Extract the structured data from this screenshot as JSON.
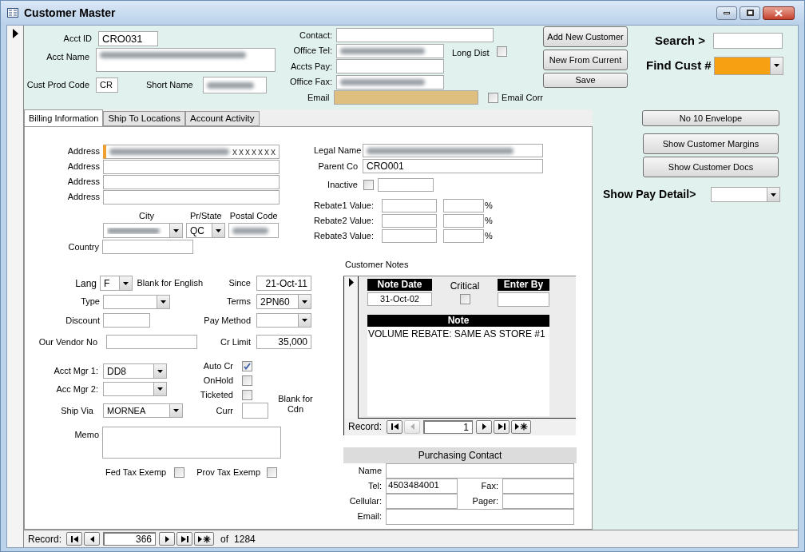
{
  "window": {
    "title": "Customer Master"
  },
  "header": {
    "acct_id": {
      "label": "Acct ID",
      "value": "CRO031"
    },
    "acct_name": {
      "label": "Acct Name",
      "redacted": true
    },
    "cust_prod_code": {
      "label": "Cust Prod Code",
      "value": "CR"
    },
    "short_name": {
      "label": "Short Name",
      "redacted": true
    },
    "contact_fields": [
      {
        "label": "Contact:",
        "redacted": false,
        "highlighted": false
      },
      {
        "label": "Office Tel:",
        "redacted": true,
        "highlighted": false
      },
      {
        "label": "Accts Pay:",
        "redacted": false,
        "highlighted": false
      },
      {
        "label": "Office Fax:",
        "redacted": true,
        "highlighted": false
      },
      {
        "label": "Email",
        "redacted": false,
        "highlighted": true
      }
    ],
    "long_dist": {
      "label": "Long Dist",
      "checked": false
    },
    "email_corr": {
      "label": "Email Corr",
      "checked": false
    },
    "buttons": [
      "Add New Customer",
      "New From Current",
      "Save"
    ],
    "search": {
      "label": "Search >"
    },
    "find_cust": {
      "label": "Find Cust #",
      "highlighted": true
    }
  },
  "tabs": [
    {
      "label": "Billing Information",
      "selected": true
    },
    {
      "label": "Ship To Locations",
      "selected": false
    },
    {
      "label": "Account Activity",
      "selected": false
    }
  ],
  "side_buttons": [
    "No 10 Envelope",
    "Show Customer Margins",
    "Show Customer Docs"
  ],
  "pay_detail": {
    "label": "Show Pay Detail>"
  },
  "billing": {
    "addresses": [
      {
        "label": "Address",
        "value": "xxxxxxx",
        "redacted": true,
        "focused": true
      },
      {
        "label": "Address",
        "redacted": false,
        "focused": false
      },
      {
        "label": "Address",
        "redacted": false,
        "focused": false
      },
      {
        "label": "Address",
        "redacted": false,
        "focused": false
      }
    ],
    "city": {
      "label": "City",
      "redacted": true
    },
    "state": {
      "label": "Pr/State",
      "value": "QC"
    },
    "postal": {
      "label": "Postal Code",
      "redacted": true
    },
    "country": {
      "label": "Country"
    },
    "lang": {
      "label": "Lang",
      "value": "F",
      "hint": "Blank for English"
    },
    "type": {
      "label": "Type"
    },
    "discount": {
      "label": "Discount"
    },
    "vendor_no": {
      "label": "Our Vendor No"
    },
    "since": {
      "label": "Since",
      "value": "21-Oct-11"
    },
    "terms": {
      "label": "Terms",
      "value": "2PN60"
    },
    "pay_method": {
      "label": "Pay Method"
    },
    "cr_limit": {
      "label": "Cr Limit",
      "value": "35,000"
    },
    "acct_mgr_1": {
      "label": "Acct Mgr 1:",
      "value": "DD8"
    },
    "acct_mgr_2": {
      "label": "Acc Mgr 2:"
    },
    "ship_via": {
      "label": "Ship Via",
      "value": "MORNEA"
    },
    "flags": [
      {
        "label": "Auto Cr",
        "checked": true
      },
      {
        "label": "OnHold",
        "checked": false
      },
      {
        "label": "Ticketed",
        "checked": false
      }
    ],
    "curr": {
      "label": "Curr",
      "hint": "Blank for Cdn"
    },
    "memo": {
      "label": "Memo"
    },
    "tax": [
      {
        "label": "Fed Tax Exemp",
        "checked": false
      },
      {
        "label": "Prov Tax Exemp",
        "checked": false
      }
    ],
    "legal_name": {
      "label": "Legal Name",
      "redacted": true
    },
    "parent_co": {
      "label": "Parent Co",
      "value": "CRO001"
    },
    "inactive": {
      "label": "Inactive",
      "checked": false
    },
    "rebates": [
      {
        "label": "Rebate1 Value:",
        "unit": "%"
      },
      {
        "label": "Rebate2 Value:",
        "unit": "%"
      },
      {
        "label": "Rebate3 Value:",
        "unit": "%"
      }
    ],
    "notes": {
      "label": "Customer Notes",
      "note_date": {
        "label": "Note Date",
        "value": "31-Oct-02"
      },
      "critical": {
        "label": "Critical",
        "checked": false
      },
      "enter_by": {
        "label": "Enter By"
      },
      "note": {
        "label": "Note",
        "value": "VOLUME REBATE: SAME AS STORE #1"
      },
      "nav": {
        "label": "Record:",
        "value": "1",
        "buttons": [
          {
            "kind": "first",
            "disabled": false
          },
          {
            "kind": "prev",
            "disabled": true
          },
          {
            "kind": "next",
            "disabled": false
          },
          {
            "kind": "last",
            "disabled": false
          },
          {
            "kind": "new",
            "disabled": false
          }
        ]
      }
    },
    "purchasing_contact": {
      "title": "Purchasing Contact",
      "name": {
        "label": "Name"
      },
      "tel": {
        "label": "Tel:",
        "value": "4503484001"
      },
      "fax": {
        "label": "Fax:"
      },
      "cellular": {
        "label": "Cellular:"
      },
      "pager": {
        "label": "Pager:"
      },
      "email": {
        "label": "Email:"
      }
    }
  },
  "record_nav": {
    "label": "Record:",
    "value": "366",
    "of": "of",
    "total": "1284",
    "buttons": [
      {
        "kind": "first",
        "disabled": false
      },
      {
        "kind": "prev",
        "disabled": false
      },
      {
        "kind": "next",
        "disabled": false
      },
      {
        "kind": "last",
        "disabled": false
      },
      {
        "kind": "new",
        "disabled": false
      }
    ]
  }
}
